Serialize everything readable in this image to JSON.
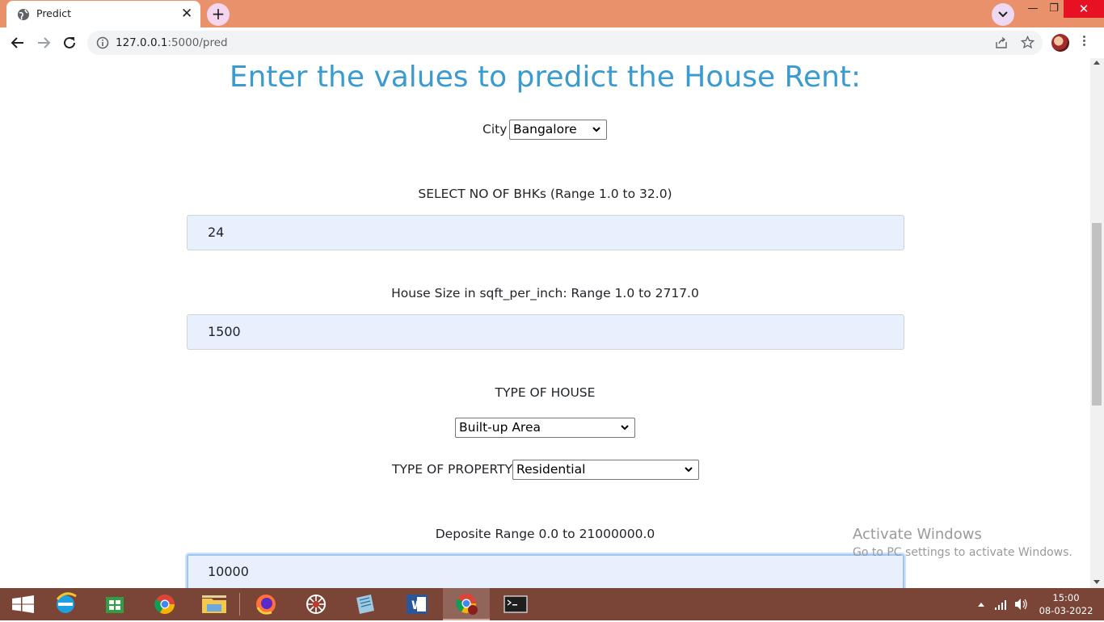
{
  "browser": {
    "tab_title": "Predict",
    "tab_close": "✕",
    "new_tab": "+",
    "url_host": "127.0.0.1",
    "url_path": ":5000/pred",
    "window_min": "—",
    "window_restore": "❐",
    "window_close": "✕"
  },
  "page": {
    "heading": "Enter the values to predict the House Rent:",
    "city_label": "City",
    "city_value": "Bangalore",
    "bhk_label": "SELECT NO OF BHKs (Range 1.0 to 32.0)",
    "bhk_value": "24",
    "size_label": "House Size in sqft_per_inch: Range 1.0 to 2717.0",
    "size_value": "1500",
    "house_type_label": "TYPE OF HOUSE",
    "house_type_value": "Built-up Area",
    "property_type_label": "TYPE OF PROPERTY",
    "property_type_value": "Residential",
    "deposit_label": "Deposite Range 0.0 to 21000000.0",
    "deposit_value": "10000"
  },
  "watermark": {
    "title": "Activate Windows",
    "subtitle": "Go to PC settings to activate Windows."
  },
  "taskbar": {
    "apps": [
      "start-icon",
      "internet-explorer-icon",
      "store-icon",
      "chrome-icon",
      "file-explorer-icon",
      "firefox-icon",
      "spider-app-icon",
      "notepad-icon",
      "word-icon",
      "chrome-active-icon",
      "terminal-icon"
    ],
    "time": "15:00",
    "date": "08-03-2022"
  },
  "colors": {
    "titlebar": "#e8916a",
    "heading": "#3a9bd1",
    "field_bg": "#e8f0fe",
    "taskbar": "#7a4437"
  }
}
